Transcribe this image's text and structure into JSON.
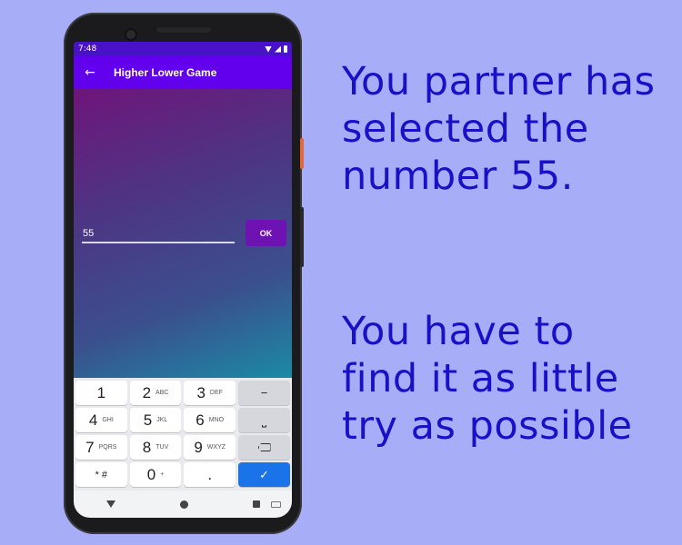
{
  "status_bar": {
    "time": "7:48"
  },
  "app_bar": {
    "title": "Higher Lower Game",
    "back_icon": "arrow-left-icon"
  },
  "guess": {
    "input_value": "55",
    "ok_label": "OK"
  },
  "keyboard": {
    "rows": [
      [
        {
          "main": "1",
          "sub": ""
        },
        {
          "main": "2",
          "sub": "ABC"
        },
        {
          "main": "3",
          "sub": "DEF"
        },
        {
          "main": "−",
          "sub": "",
          "func": true
        }
      ],
      [
        {
          "main": "4",
          "sub": "GHI"
        },
        {
          "main": "5",
          "sub": "JKL"
        },
        {
          "main": "6",
          "sub": "MNO"
        },
        {
          "main": "⎵",
          "sub": "",
          "func": true
        }
      ],
      [
        {
          "main": "7",
          "sub": "PQRS"
        },
        {
          "main": "8",
          "sub": "TUV"
        },
        {
          "main": "9",
          "sub": "WXYZ"
        },
        {
          "main": "",
          "sub": "",
          "func": true,
          "icon": "backspace-icon"
        }
      ],
      [
        {
          "main": "* #",
          "sub": "",
          "small": true
        },
        {
          "main": "0",
          "sub": "+"
        },
        {
          "main": ".",
          "sub": ""
        },
        {
          "main": "✓",
          "sub": "",
          "enter": true
        }
      ]
    ]
  },
  "caption": {
    "line1": "You partner has selected the number 55.",
    "line2": "You have to find it as little try as possible"
  },
  "colors": {
    "background": "#a8adf7",
    "caption_text": "#1a10c8",
    "app_bar": "#6200ee",
    "ok_button": "#6e12b4",
    "enter_key": "#1a73e8"
  }
}
